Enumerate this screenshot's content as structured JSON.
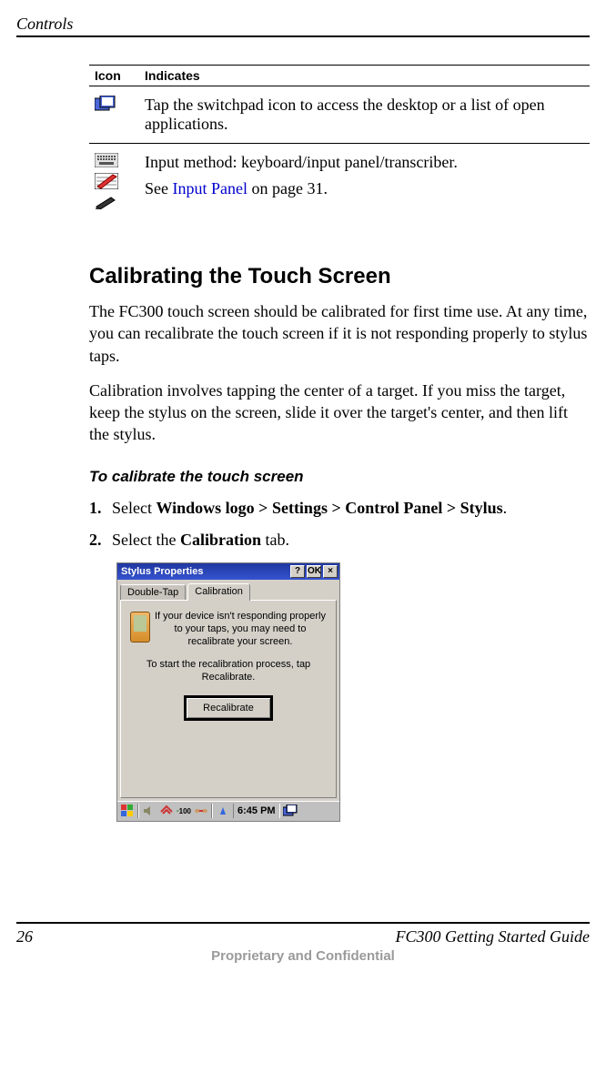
{
  "header": {
    "section": "Controls"
  },
  "icon_table": {
    "headers": {
      "icon": "Icon",
      "indicates": "Indicates"
    },
    "rows": [
      {
        "icons": [
          "switchpad-icon"
        ],
        "text": "Tap the switchpad icon to access the desktop or a list of open applications."
      },
      {
        "icons": [
          "keyboard-icon",
          "input-panel-icon",
          "pencil-icon"
        ],
        "text_before": "Input method: keyboard/input panel/transcriber.",
        "see_prefix": "See ",
        "link_text": "Input Panel",
        "see_suffix": " on page 31."
      }
    ]
  },
  "section_title": "Calibrating the Touch Screen",
  "paragraphs": [
    "The FC300 touch screen should be calibrated for first time use. At any time, you can recalibrate the touch screen if it is not responding properly to stylus taps.",
    "Calibration involves tapping the center of a target. If you miss the target, keep the stylus on the screen, slide it over the target's center, and then lift the stylus."
  ],
  "procedure_title": "To calibrate the touch screen",
  "steps": [
    {
      "num": "1.",
      "pre": "Select ",
      "bold": "Windows logo > Settings > Control Panel > Stylus",
      "post": "."
    },
    {
      "num": "2.",
      "pre": "Select the ",
      "bold": "Calibration",
      "post": " tab."
    }
  ],
  "dialog": {
    "title": "Stylus Properties",
    "buttons": {
      "help": "?",
      "ok": "OK",
      "close": "×"
    },
    "tabs": {
      "double_tap": "Double-Tap",
      "calibration": "Calibration"
    },
    "text1": "If your device isn't responding properly to your taps, you may need to recalibrate your screen.",
    "text2": "To start the recalibration process,   tap Recalibrate.",
    "recalibrate": "Recalibrate",
    "taskbar": {
      "conn_label": "100",
      "time": "6:45 PM"
    }
  },
  "footer": {
    "page_number": "26",
    "guide_title": "FC300  Getting Started Guide",
    "confidential": "Proprietary and Confidential"
  }
}
